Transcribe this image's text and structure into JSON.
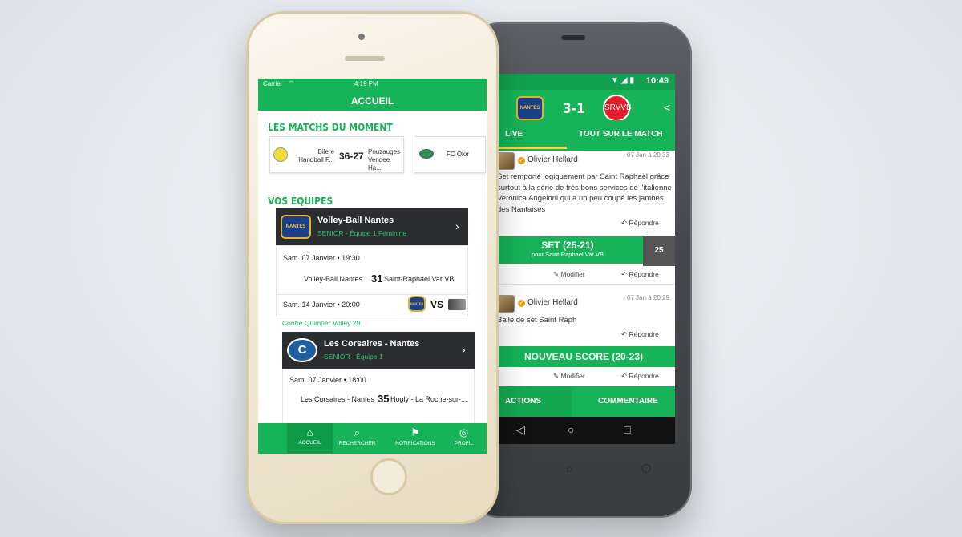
{
  "android": {
    "status": {
      "time": "10:49",
      "icons": "▼◢▮"
    },
    "header": {
      "back_icon": "←",
      "home_logo_text": "NANTES",
      "score": "3-1",
      "away_logo_text": "SRVVB",
      "share_icon": "<"
    },
    "tabs": [
      {
        "label": "LIVE"
      },
      {
        "label": "TOUT SUR LE MATCH"
      }
    ],
    "posts": [
      {
        "author": "Olivier Hellard",
        "date": "07 Jan à 20:33",
        "text": "Set remporté logiquement par Saint Raphaël grâce surtout à la série de très bons services de l'italienne Veronica Angeloni qui a un peu coupé les jambes des Nantaises",
        "reply": "Répondre"
      },
      {
        "author": "Olivier Hellard",
        "date": "07 Jan à 20:29",
        "text": "Balle de set Saint Raph",
        "reply": "Répondre"
      }
    ],
    "set_event": {
      "title": "SET (25-21)",
      "subtitle": "pour Saint-Raphael Var VB",
      "badge": "25",
      "edit": "Modifier",
      "reply": "Répondre"
    },
    "score_event": {
      "title": "NOUVEAU SCORE (20-23)",
      "edit": "Modifier",
      "reply": "Répondre"
    },
    "bottom": {
      "actions": "ACTIONS",
      "comment": "COMMENTAIRE"
    },
    "nav": {
      "back": "◁",
      "home": "○",
      "recent": "□"
    }
  },
  "iphone": {
    "status": {
      "carrier": "Carrier",
      "time": "4:19 PM"
    },
    "nav_title": "ACCUEIL",
    "section_matches": "LES MATCHS DU MOMENT",
    "matches": [
      {
        "home": "Bilere Handball P...",
        "score": "36-27",
        "away": "Pouzauges Vendee Ha..."
      },
      {
        "home": "FC Olor"
      }
    ],
    "section_teams": "VOS ÉQUIPES",
    "teams": [
      {
        "name": "Volley-Ball Nantes",
        "logo_text": "NANTES",
        "category": "SENIOR - Équipe 1 Féminine",
        "last": {
          "date": "Sam. 07 Janvier • 19:30",
          "home": "Volley-Ball Nantes",
          "score": "31",
          "away": "Saint-Raphael Var VB"
        },
        "next": {
          "date": "Sam. 14 Janvier • 20:00",
          "vs": "VS",
          "opponent": "Contre Quimper Volley 29"
        }
      },
      {
        "name": "Les Corsaires - Nantes",
        "logo_text": "C",
        "category": "SENIOR - Équipe 1",
        "last": {
          "date": "Sam. 07 Janvier • 18:00",
          "home": "Les Corsaires - Nantes",
          "score": "35",
          "away": "Hogly - La Roche-sur-..."
        }
      }
    ],
    "tabbar": [
      {
        "label": "ACCUEIL",
        "icon": "⌂"
      },
      {
        "label": "RECHERCHER",
        "icon": "⌕"
      },
      {
        "label": "NOTIFICATIONS",
        "icon": "⚑"
      },
      {
        "label": "PROFIL",
        "icon": "◎"
      }
    ]
  }
}
